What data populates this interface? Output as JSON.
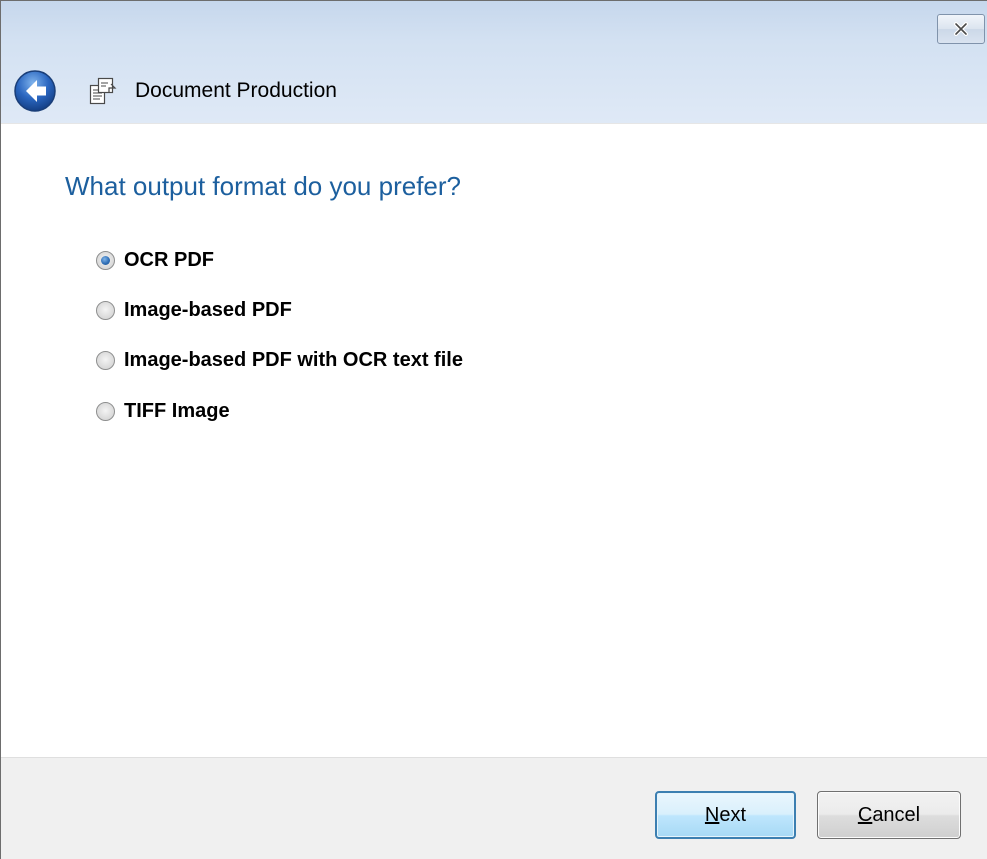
{
  "window": {
    "title": "Document Production",
    "close_label": "Close"
  },
  "content": {
    "question": "What output format do you prefer?",
    "options": [
      {
        "label": "OCR PDF",
        "checked": true
      },
      {
        "label": "Image-based PDF",
        "checked": false
      },
      {
        "label": "Image-based PDF with OCR text file",
        "checked": false
      },
      {
        "label": "TIFF Image",
        "checked": false
      }
    ]
  },
  "footer": {
    "next_mnemonic": "N",
    "next_rest": "ext",
    "cancel_mnemonic": "C",
    "cancel_rest": "ancel"
  },
  "colors": {
    "question_text": "#1c5f9e",
    "titlebar_glass": "#d3e1f2",
    "footer_background": "#f0f0f0",
    "default_button_border": "#3c7fb1"
  },
  "icons": {
    "back": "back-arrow-icon",
    "document": "document-production-icon",
    "close": "close-icon"
  }
}
